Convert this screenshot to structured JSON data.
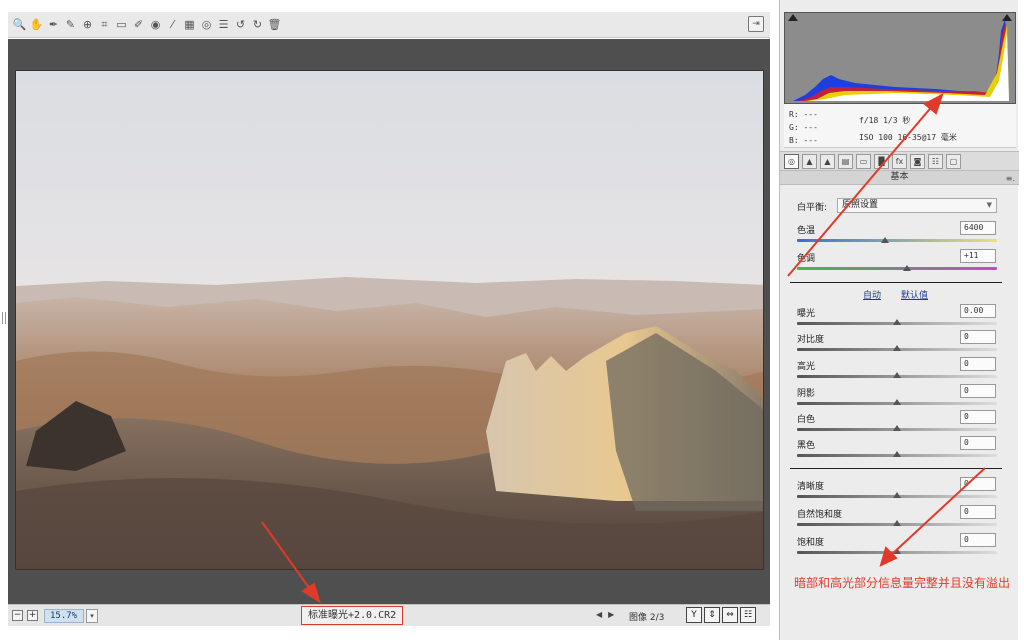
{
  "toolbar": {
    "tools": [
      {
        "name": "zoom-tool-icon",
        "glyph": "🔍"
      },
      {
        "name": "hand-tool-icon",
        "glyph": "✋"
      },
      {
        "name": "white-balance-tool-icon",
        "glyph": "✒"
      },
      {
        "name": "color-sampler-tool-icon",
        "glyph": "✎"
      },
      {
        "name": "targeted-adjustment-tool-icon",
        "glyph": "⊕"
      },
      {
        "name": "crop-tool-icon",
        "glyph": "⌗"
      },
      {
        "name": "straighten-tool-icon",
        "glyph": "▭"
      },
      {
        "name": "spot-removal-tool-icon",
        "glyph": "✐"
      },
      {
        "name": "red-eye-tool-icon",
        "glyph": "◉"
      },
      {
        "name": "adjustment-brush-icon",
        "glyph": "⁄"
      },
      {
        "name": "graduated-filter-icon",
        "glyph": "▦"
      },
      {
        "name": "radial-filter-icon",
        "glyph": "◎"
      },
      {
        "name": "preferences-icon",
        "glyph": "☰"
      },
      {
        "name": "rotate-left-icon",
        "glyph": "↺"
      },
      {
        "name": "rotate-right-icon",
        "glyph": "↻"
      },
      {
        "name": "trash-icon",
        "glyph": "🗑"
      }
    ],
    "fullscreen_glyph": "⇥"
  },
  "histogram": {
    "colors": {
      "red": "#e01b1b",
      "green": "#1bb01b",
      "blue": "#1d3fe0",
      "yellow": "#f0e000",
      "white": "#ffffff"
    }
  },
  "readout": {
    "r": "R:  ---",
    "g": "G:  ---",
    "b": "B:  ---",
    "exif_line1": "f/18   1/3 秒",
    "exif_line2": "ISO 100   16-35@17 毫米"
  },
  "panel": {
    "tabs": [
      "◎",
      "▲",
      "▲",
      "▤",
      "▭",
      "▐▌",
      "fx",
      "◙",
      "☷",
      "▢"
    ],
    "section_title": "基本",
    "menu_glyph": "≡.",
    "white_balance_label": "白平衡:",
    "white_balance_value": "原照设置",
    "temperature_label": "色温",
    "temperature_value": "6400",
    "tint_label": "色调",
    "tint_value": "+11",
    "auto_label": "自动",
    "default_label": "默认值",
    "adjustments": [
      {
        "label": "曝光",
        "value": "0.00"
      },
      {
        "label": "对比度",
        "value": "0"
      },
      {
        "label": "高光",
        "value": "0"
      },
      {
        "label": "阴影",
        "value": "0"
      },
      {
        "label": "白色",
        "value": "0"
      },
      {
        "label": "黑色",
        "value": "0"
      }
    ],
    "presence": [
      {
        "label": "清晰度",
        "value": "0"
      },
      {
        "label": "自然饱和度",
        "value": "0"
      },
      {
        "label": "饱和度",
        "value": "0"
      }
    ],
    "annotation": "暗部和高光部分信息量完整并且没有溢出"
  },
  "status": {
    "zoom_out": "−",
    "zoom_in": "+",
    "zoom_value": "15.7%",
    "zoom_dropdown": "▾",
    "filename": "标准曝光+2.0.CR2",
    "prev": "◀",
    "next": "▶",
    "image_count": "图像 2/3",
    "view_buttons": [
      "Y",
      "⇕",
      "⇔",
      "☷"
    ]
  },
  "accent_color": "#e03a2a"
}
